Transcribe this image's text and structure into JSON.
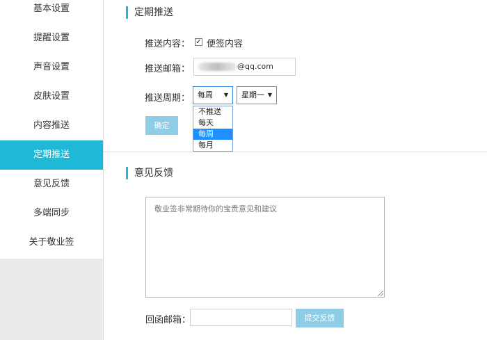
{
  "sidebar": {
    "items": [
      {
        "label": "基本设置",
        "active": false
      },
      {
        "label": "提醒设置",
        "active": false
      },
      {
        "label": "声音设置",
        "active": false
      },
      {
        "label": "皮肤设置",
        "active": false
      },
      {
        "label": "内容推送",
        "active": false
      },
      {
        "label": "定期推送",
        "active": true
      },
      {
        "label": "意见反馈",
        "active": false
      },
      {
        "label": "多端同步",
        "active": false
      },
      {
        "label": "关于敬业签",
        "active": false
      }
    ]
  },
  "periodic_push": {
    "title": "定期推送",
    "content_label": "推送内容：",
    "content_checkbox_checked": true,
    "content_checkbox_label": "便签内容",
    "email_label": "推送邮箱：",
    "email_suffix": "@qq.com",
    "period_label": "推送周期：",
    "period_select_value": "每周",
    "day_select_value": "星期一",
    "period_options": [
      "不推送",
      "每天",
      "每周",
      "每月"
    ],
    "period_selected_index": 2,
    "confirm_label": "确定"
  },
  "feedback": {
    "title": "意见反馈",
    "textarea_placeholder": "敬业签非常期待你的宝贵意见和建议",
    "reply_email_label": "回函邮箱：",
    "submit_label": "提交反馈"
  },
  "colors": {
    "accent": "#1fb8d6",
    "button": "#8fcde6",
    "dropdown_highlight": "#1e90ff"
  }
}
